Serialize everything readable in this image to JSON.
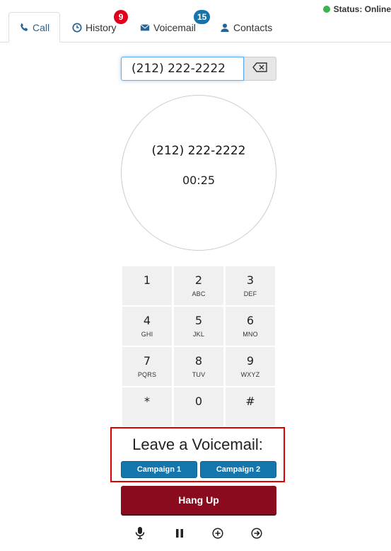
{
  "status": {
    "label": "Status: Online",
    "color": "#3cb44b"
  },
  "tabs": [
    {
      "label": "Call",
      "icon": "phone-icon",
      "active": true
    },
    {
      "label": "History",
      "icon": "clock-icon",
      "badge": "9",
      "badge_color": "#e0001b"
    },
    {
      "label": "Voicemail",
      "icon": "envelope-icon",
      "badge": "15",
      "badge_color": "#1874a8"
    },
    {
      "label": "Contacts",
      "icon": "user-icon"
    }
  ],
  "dialer": {
    "number_value": "(212) 222-2222",
    "backspace_icon": "backspace-icon"
  },
  "call": {
    "number": "(212) 222-2222",
    "timer": "00:25"
  },
  "keypad": [
    {
      "digit": "1",
      "letters": ""
    },
    {
      "digit": "2",
      "letters": "ABC"
    },
    {
      "digit": "3",
      "letters": "DEF"
    },
    {
      "digit": "4",
      "letters": "GHI"
    },
    {
      "digit": "5",
      "letters": "JKL"
    },
    {
      "digit": "6",
      "letters": "MNO"
    },
    {
      "digit": "7",
      "letters": "PQRS"
    },
    {
      "digit": "8",
      "letters": "TUV"
    },
    {
      "digit": "9",
      "letters": "WXYZ"
    },
    {
      "digit": "*",
      "letters": ""
    },
    {
      "digit": "0",
      "letters": ""
    },
    {
      "digit": "#",
      "letters": ""
    }
  ],
  "voicemail_drop": {
    "title": "Leave a Voicemail:",
    "campaigns": [
      "Campaign 1",
      "Campaign 2"
    ]
  },
  "actions": {
    "hangup_label": "Hang Up",
    "hangup_color": "#8a0a1e",
    "icons": [
      "microphone-icon",
      "pause-icon",
      "add-call-icon",
      "transfer-icon"
    ]
  }
}
